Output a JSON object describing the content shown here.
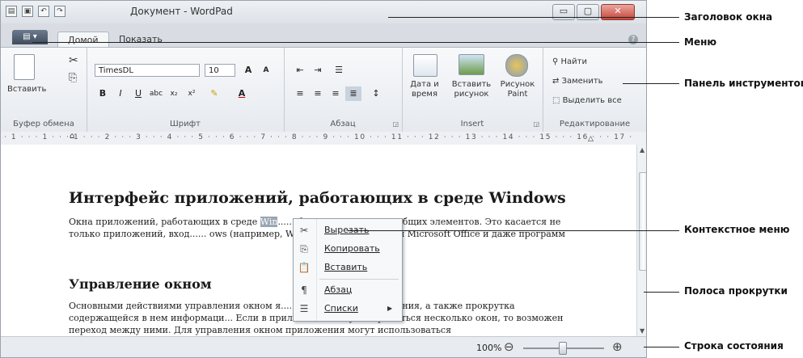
{
  "window": {
    "title": "Документ - WordPad",
    "controls": {
      "minimize": "▭",
      "maximize": "▢",
      "close": "✕"
    }
  },
  "quick_access_icons": [
    "app-icon",
    "save-icon",
    "undo-icon",
    "redo-icon"
  ],
  "menu": {
    "file_tab": "▤ ▾",
    "tabs": [
      "Домой",
      "Показать"
    ],
    "help": "?"
  },
  "ribbon": {
    "clipboard": {
      "label": "Буфер обмена",
      "paste": "Вставить"
    },
    "font": {
      "label": "Шрифт",
      "font_name": "TimesDL",
      "font_size": "10"
    },
    "paragraph": {
      "label": "Абзац"
    },
    "insert": {
      "label": "Insert",
      "datetime": "Дата и время",
      "picture": "Вставить рисунок",
      "paint": "Рисунок Paint"
    },
    "editing": {
      "label": "Редактирование",
      "find": "Найти",
      "replace": "Заменить",
      "select_all": "Выделить все"
    }
  },
  "ruler": "· 1 · · · 1 · · · 1 · · · 2 · · · 3 · · · 4 · · · 5 · · · 6 · · · 7 · · · 8 · · · 9 · · · 10 · · · 11 · · · 12 · · · 13 · · · 14 · · · 15 · · · 16 · · · 17 ·",
  "document": {
    "heading1": "Интерфейс приложений, работающих в среде Windows",
    "para1_before": "Окна приложений, работающих в среде ",
    "para1_selected": "Win",
    "para1_after": "...... большое количество общих элементов. Это касается не только приложений, вход...... ows (например, WordPad), но и программ Microsoft Office и даже программ",
    "heading2": "Управление окном",
    "para2": "Основными действиями управления окном я......то размеров и положения, а также прокрутка содержащейся в нем информаци... Если в приложении могут открываться несколько окон, то возможен переход между ними. Для управления окном приложения могут использоваться"
  },
  "context_menu": {
    "items": [
      {
        "icon": "✂",
        "label": "Вырезать"
      },
      {
        "icon": "⎘",
        "label": "Копировать"
      },
      {
        "icon": "📋",
        "label": "Вставить"
      },
      {
        "icon": "¶",
        "label": "Абзац"
      },
      {
        "icon": "☰",
        "label": "Списки",
        "arrow": "▶"
      }
    ]
  },
  "statusbar": {
    "zoom": "100%",
    "zoom_out": "⊖",
    "zoom_in": "⊕"
  },
  "callouts": {
    "title": "Заголовок окна",
    "menu": "Меню",
    "toolbar": "Панель инструментов",
    "context_menu": "Контекстное меню",
    "scrollbar": "Полоса прокрутки",
    "statusbar": "Строка состояния"
  }
}
